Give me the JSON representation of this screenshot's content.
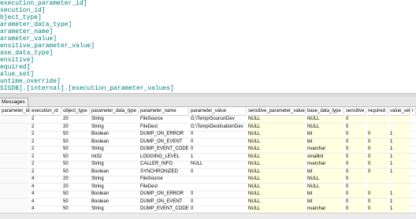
{
  "editor": {
    "lines": [
      "execution_parameter_id]",
      "xecution_id]",
      "bject_type]",
      "arameter_data_type]",
      "arameter_name]",
      "arameter_value]",
      "ensitive_parameter_value]",
      "ase_data_type]",
      "ensitive]",
      "equired]",
      "alue_set]",
      "untime_override]",
      "SISDB].[internal].[execution_parameter_values]"
    ]
  },
  "results": {
    "tab_label": "Messages",
    "columns": [
      "parameter_id",
      "execution_id",
      "object_type",
      "parameter_data_type",
      "parameter_name",
      "parameter_value",
      "sensitive_parameter_value",
      "base_data_type",
      "sensitive",
      "required",
      "value_set",
      "r"
    ],
    "rows": [
      [
        "",
        "2",
        "20",
        "String",
        "FileSource",
        "G:\\Temp\\Source\\Dev",
        "NULL",
        "NULL",
        "0",
        "",
        "",
        ""
      ],
      [
        "",
        "2",
        "20",
        "String",
        "FileDest",
        "G:\\Temp\\Destination\\Dev",
        "NULL",
        "NULL",
        "0",
        "",
        "",
        ""
      ],
      [
        "",
        "2",
        "50",
        "Boolean",
        "DUMP_ON_ERROR",
        "0",
        "NULL",
        "bit",
        "0",
        "0",
        "1",
        ""
      ],
      [
        "",
        "2",
        "50",
        "Boolean",
        "DUMP_ON_EVENT",
        "0",
        "NULL",
        "bit",
        "0",
        "0",
        "1",
        ""
      ],
      [
        "",
        "2",
        "50",
        "String",
        "DUMP_EVENT_CODE",
        "0",
        "NULL",
        "nvarchar",
        "0",
        "0",
        "1",
        ""
      ],
      [
        "",
        "2",
        "50",
        "Int32",
        "LOGGING_LEVEL",
        "1",
        "NULL",
        "smallint",
        "0",
        "0",
        "1",
        ""
      ],
      [
        "",
        "2",
        "50",
        "String",
        "CALLER_INFO",
        "NULL",
        "NULL",
        "nvarchar",
        "0",
        "0",
        "1",
        ""
      ],
      [
        "",
        "2",
        "50",
        "Boolean",
        "SYNCHRONIZED",
        "0",
        "NULL",
        "bit",
        "0",
        "0",
        "1",
        ""
      ],
      [
        "",
        "4",
        "20",
        "String",
        "FileSource",
        "",
        "NULL",
        "NULL",
        "0",
        "",
        "",
        ""
      ],
      [
        "",
        "4",
        "20",
        "String",
        "FileDest",
        "",
        "NULL",
        "NULL",
        "0",
        "",
        "",
        ""
      ],
      [
        "",
        "4",
        "50",
        "Boolean",
        "DUMP_ON_ERROR",
        "0",
        "NULL",
        "bit",
        "0",
        "0",
        "1",
        ""
      ],
      [
        "",
        "4",
        "50",
        "Boolean",
        "DUMP_ON_EVENT",
        "0",
        "NULL",
        "bit",
        "0",
        "0",
        "1",
        ""
      ],
      [
        "",
        "4",
        "50",
        "String",
        "DUMP_EVENT_CODE",
        "0",
        "NULL",
        "nvarchar",
        "0",
        "0",
        "1",
        ""
      ]
    ]
  },
  "colors": {
    "code_text": "#008080",
    "null_highlight": "#ffffe1"
  }
}
